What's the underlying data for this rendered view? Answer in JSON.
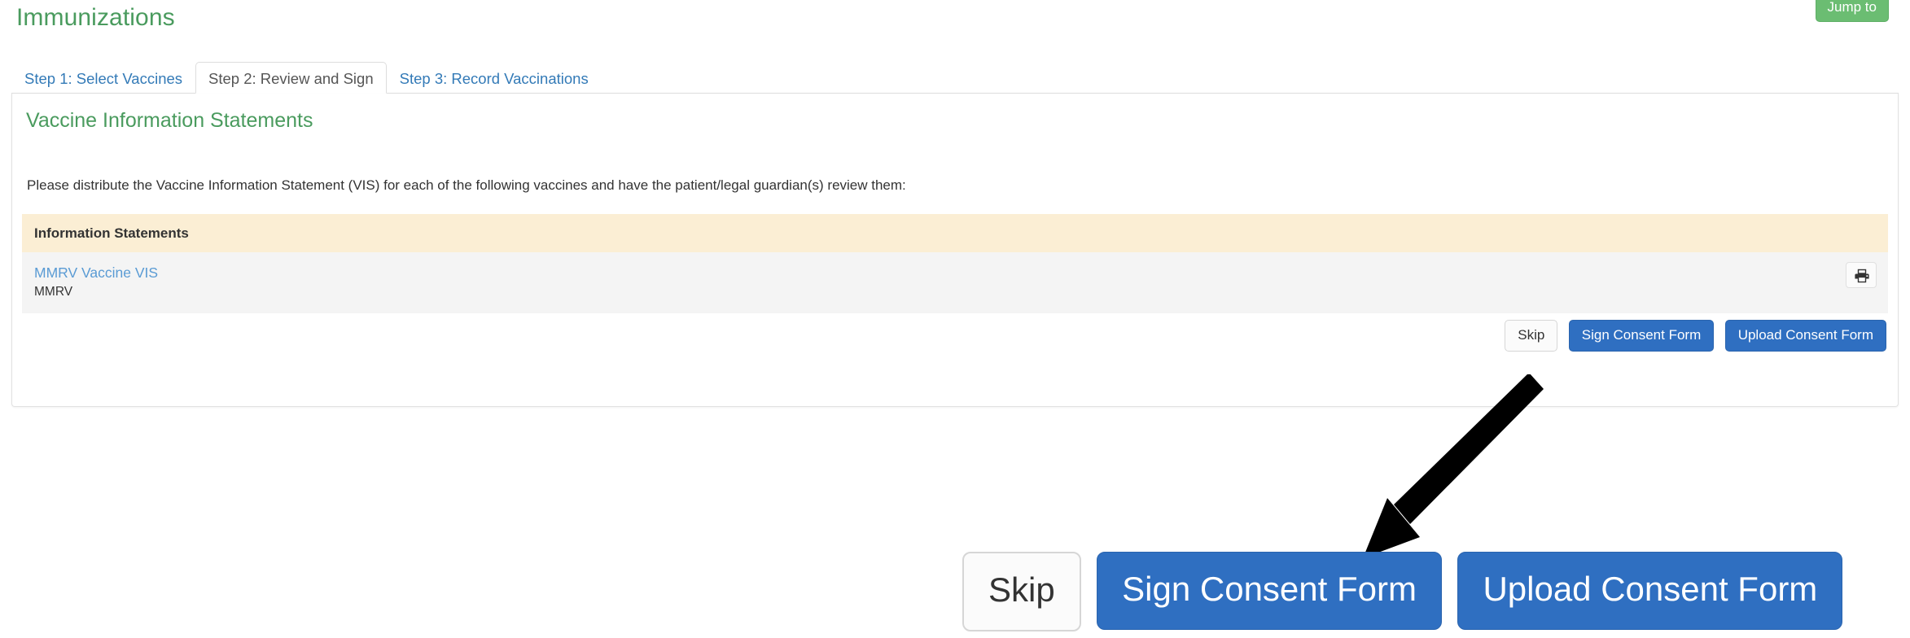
{
  "header": {
    "title": "Immunizations",
    "jump_to_label": "Jump to"
  },
  "tabs": [
    {
      "label": "Step 1: Select Vaccines",
      "active": false
    },
    {
      "label": "Step 2: Review and Sign",
      "active": true
    },
    {
      "label": "Step 3: Record Vaccinations",
      "active": false
    }
  ],
  "panel": {
    "heading": "Vaccine Information Statements",
    "instructions": "Please distribute the Vaccine Information Statement (VIS) for each of the following vaccines and have the patient/legal guardian(s) review them:"
  },
  "table": {
    "columns": [
      "Information Statements"
    ],
    "rows": [
      {
        "link_label": "MMRV Vaccine VIS",
        "subtext": "MMRV",
        "action_icon": "printer-icon"
      }
    ]
  },
  "actions": {
    "skip_label": "Skip",
    "sign_label": "Sign Consent Form",
    "upload_label": "Upload Consent Form"
  },
  "colors": {
    "brand_green": "#4a9b5e",
    "jump_to_green": "#6bbd72",
    "link_blue": "#337ab7",
    "vis_link_blue": "#5a9bd4",
    "primary_button_blue": "#2f6fc1",
    "table_header_beige": "#fbeed4",
    "table_row_gray": "#f4f4f4"
  }
}
